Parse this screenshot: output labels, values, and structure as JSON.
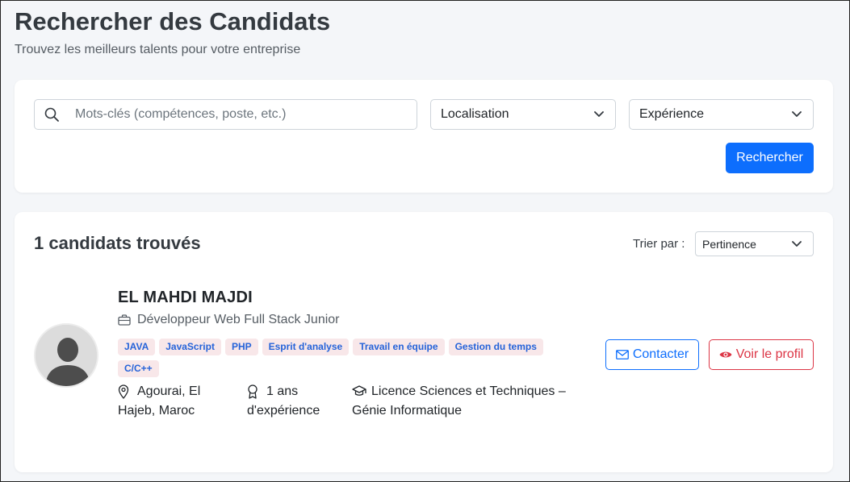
{
  "header": {
    "title": "Rechercher des Candidats",
    "subtitle": "Trouvez les meilleurs talents pour votre entreprise"
  },
  "search": {
    "keywords_placeholder": "Mots-clés (compétences, poste, etc.)",
    "location_value": "Localisation",
    "experience_value": "Expérience",
    "submit_label": "Rechercher",
    "accent_color": "#0d6efd"
  },
  "results": {
    "count_label": "1 candidats trouvés",
    "sort_label": "Trier par :",
    "sort_value": "Pertinence",
    "candidates": [
      {
        "name": "EL MAHDI MAJDI",
        "role": "Développeur Web Full Stack Junior",
        "skills": [
          "JAVA",
          "JavaScript",
          "PHP",
          "Esprit d'analyse",
          "Travail en équipe",
          "Gestion du temps",
          "C/C++"
        ],
        "location": "Agourai, El Hajeb, Maroc",
        "experience": "1 ans d'expérience",
        "education": "Licence Sciences et Techniques – Génie Informatique",
        "contact_label": "Contacter",
        "profile_label": "Voir le profil"
      }
    ]
  },
  "icons": {
    "search": "search-icon",
    "briefcase": "briefcase-icon",
    "location": "map-pin-icon",
    "experience": "award-icon",
    "education": "graduation-cap-icon",
    "contact": "envelope-icon",
    "profile": "eye-icon",
    "chevron": "chevron-down-icon"
  }
}
